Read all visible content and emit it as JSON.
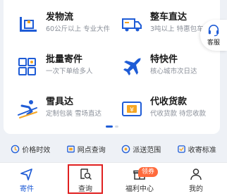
{
  "services": [
    {
      "title": "发物流",
      "subtitle": "60公斤以上 专业大件",
      "icon": "pallet-box-icon"
    },
    {
      "title": "整车直达",
      "subtitle": "3吨以上 特惠包车",
      "icon": "truck-icon"
    },
    {
      "title": "批量寄件",
      "subtitle": "一次下单给多人",
      "icon": "batch-grid-icon"
    },
    {
      "title": "特快件",
      "subtitle": "核心城市次日达",
      "icon": "airplane-icon"
    },
    {
      "title": "雪具达",
      "subtitle": "定制包装 雪场直达",
      "icon": "skier-icon"
    },
    {
      "title": "代收货款",
      "subtitle": "代收货款 待您收款",
      "icon": "yuan-card-icon"
    }
  ],
  "customer_service": {
    "label": "客服",
    "icon": "headset-icon"
  },
  "quick_links": [
    {
      "label": "价格时效",
      "icon": "price-time-icon"
    },
    {
      "label": "网点查询",
      "icon": "outlet-icon"
    },
    {
      "label": "派送范围",
      "icon": "delivery-range-icon"
    },
    {
      "label": "收寄标准",
      "icon": "standard-icon"
    }
  ],
  "tabs": [
    {
      "label": "寄件",
      "icon": "send-icon",
      "active": true
    },
    {
      "label": "查询",
      "icon": "search-icon",
      "active": false
    },
    {
      "label": "福利中心",
      "icon": "gift-icon",
      "active": false
    },
    {
      "label": "我的",
      "icon": "user-icon",
      "active": false
    }
  ],
  "badge": "领券",
  "colors": {
    "accent": "#1f5cd6",
    "highlight": "#e02020",
    "badge": "#ff6a3c"
  }
}
